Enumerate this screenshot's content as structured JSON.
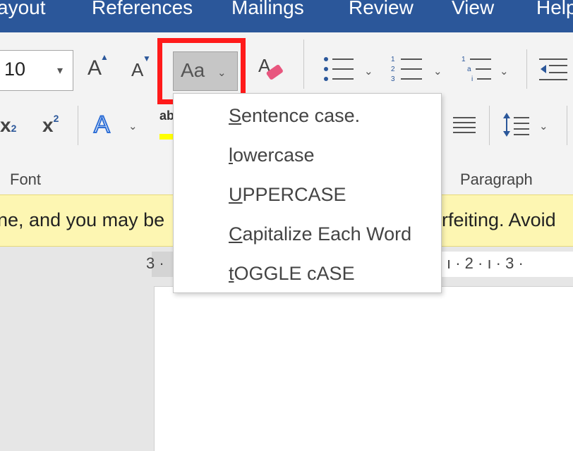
{
  "menubar": {
    "tabs": [
      {
        "label": "Layout",
        "display": "ayout"
      },
      {
        "label": "References",
        "display": "References"
      },
      {
        "label": "Mailings",
        "display": "Mailings"
      },
      {
        "label": "Review",
        "display": "Review"
      },
      {
        "label": "View",
        "display": "View"
      },
      {
        "label": "Help",
        "display": "Help"
      }
    ]
  },
  "ribbon": {
    "font_size_value": "10",
    "change_case_label": "Aa",
    "groups": {
      "font": "Font",
      "paragraph": "Paragraph"
    },
    "subscript_label": "x",
    "subscript_mark": "2",
    "superscript_label": "x",
    "superscript_mark": "2",
    "text_effects_label": "A",
    "grow_font_label": "A",
    "shrink_font_label": "A",
    "highlight_label": "ab"
  },
  "change_case_menu": {
    "items": [
      {
        "first": "S",
        "rest": "entence case.",
        "value": "Sentence case."
      },
      {
        "first": "l",
        "rest": "owercase",
        "value": "lowercase"
      },
      {
        "first": "U",
        "rest": "PPERCASE",
        "value": "UPPERCASE"
      },
      {
        "first": "C",
        "rest": "apitalize Each Word",
        "value": "Capitalize Each Word"
      },
      {
        "first": "t",
        "rest": "OGGLE cASE",
        "value": "tOGGLE cASE"
      }
    ]
  },
  "infobar": {
    "text_left": "ne, and you may be",
    "text_right": "rfeiting. Avoid"
  },
  "ruler": {
    "left_text": "3 ·",
    "right_text": "ı · 2 · ı · 3 ·"
  },
  "colors": {
    "menubar": "#2b579a",
    "highlight_frame": "#ff1a1a",
    "infobar": "#fdf6b2",
    "text_effects": "#2f6fd6",
    "highlight_bar": "#ffff00"
  },
  "icons": [
    "grow-font-icon",
    "shrink-font-icon",
    "clear-formatting-icon",
    "bullets-icon",
    "numbering-icon",
    "multilevel-list-icon",
    "decrease-indent-icon",
    "text-effects-icon",
    "highlight-icon",
    "justify-icon",
    "line-spacing-icon"
  ]
}
